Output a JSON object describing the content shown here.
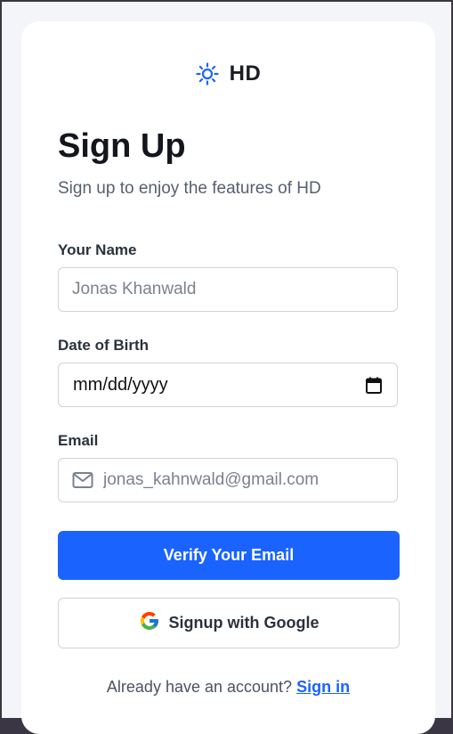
{
  "brand": {
    "name": "HD",
    "icon": "sun-icon",
    "accent_color": "#1a63ff"
  },
  "heading": {
    "title": "Sign Up",
    "subtitle": "Sign up to enjoy the features of HD"
  },
  "form": {
    "name": {
      "label": "Your Name",
      "placeholder": "Jonas Khanwald",
      "value": ""
    },
    "dob": {
      "label": "Date of Birth",
      "display_value": "mm/dd/yyyy",
      "icon": "calendar-icon"
    },
    "email": {
      "label": "Email",
      "placeholder": "jonas_kahnwald@gmail.com",
      "value": "",
      "icon": "mail-icon"
    }
  },
  "actions": {
    "verify_label": "Verify Your Email",
    "google_label": "Signup with Google",
    "google_icon": "google-icon"
  },
  "footer": {
    "prompt": "Already have an account?",
    "link_label": "Sign in"
  }
}
